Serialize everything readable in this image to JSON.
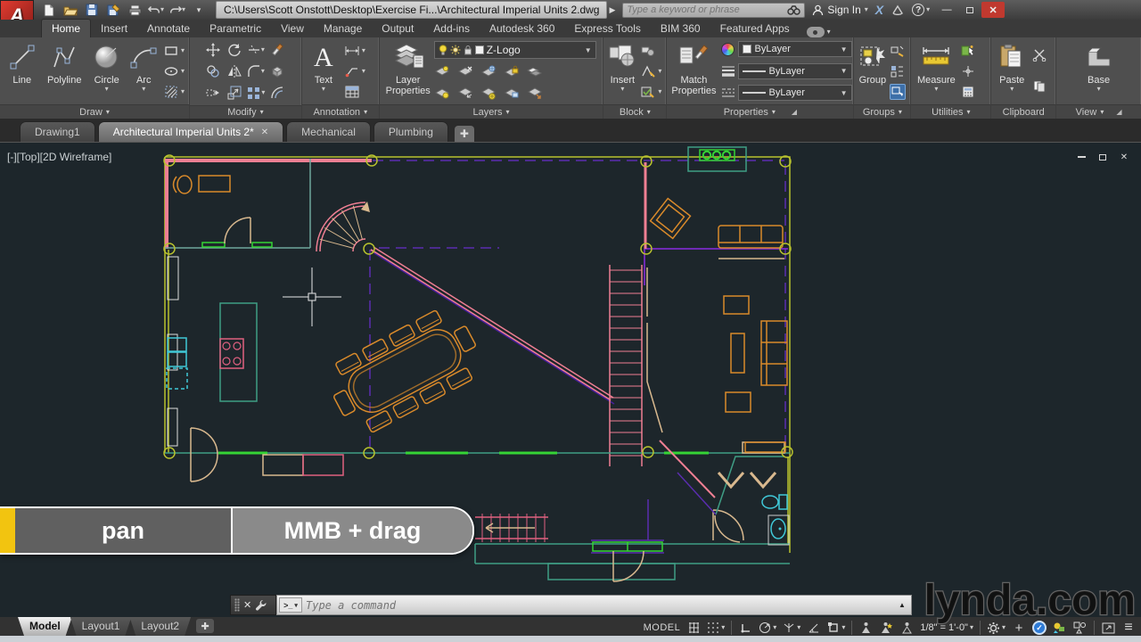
{
  "titlebar": {
    "file_path": "C:\\Users\\Scott Onstott\\Desktop\\Exercise Fi...\\Architectural Imperial Units 2.dwg",
    "search_placeholder": "Type a keyword or phrase",
    "signin": "Sign In"
  },
  "ribbon": {
    "tabs": [
      {
        "label": "Home"
      },
      {
        "label": "Insert"
      },
      {
        "label": "Annotate"
      },
      {
        "label": "Parametric"
      },
      {
        "label": "View"
      },
      {
        "label": "Manage"
      },
      {
        "label": "Output"
      },
      {
        "label": "Add-ins"
      },
      {
        "label": "Autodesk 360"
      },
      {
        "label": "Express Tools"
      },
      {
        "label": "BIM 360"
      },
      {
        "label": "Featured Apps"
      }
    ],
    "draw": {
      "label": "Draw",
      "line": "Line",
      "polyline": "Polyline",
      "circle": "Circle",
      "arc": "Arc"
    },
    "modify": {
      "label": "Modify"
    },
    "annotation": {
      "label": "Annotation",
      "text": "Text"
    },
    "layers": {
      "label": "Layers",
      "layer_properties": "Layer Properties",
      "current_layer": "Z-Logo"
    },
    "block": {
      "label": "Block",
      "insert": "Insert"
    },
    "properties": {
      "label": "Properties",
      "match": "Match Properties",
      "color": "ByLayer",
      "linetype": "ByLayer",
      "lineweight": "ByLayer"
    },
    "groups": {
      "label": "Groups",
      "group": "Group"
    },
    "utilities": {
      "label": "Utilities",
      "measure": "Measure"
    },
    "clipboard": {
      "label": "Clipboard",
      "paste": "Paste"
    },
    "view": {
      "label": "View",
      "base": "Base"
    }
  },
  "file_tabs": [
    {
      "label": "Drawing1"
    },
    {
      "label": "Architectural Imperial Units 2*"
    },
    {
      "label": "Mechanical"
    },
    {
      "label": "Plumbing"
    }
  ],
  "viewport": {
    "label": "[-][Top][2D Wireframe]"
  },
  "overlay": {
    "action": "pan",
    "shortcut": "MMB + drag",
    "accent_color": "#f2c410"
  },
  "command_line": {
    "placeholder": "Type a command"
  },
  "layout_tabs": [
    {
      "label": "Model"
    },
    {
      "label": "Layout1"
    },
    {
      "label": "Layout2"
    }
  ],
  "status_bar": {
    "space": "MODEL",
    "annotation_scale": "1/8\" = 1'-0\""
  },
  "watermark": "lynda.com",
  "canvas": {
    "background": "#1d262b",
    "colors": {
      "boundary_yellow_green": "#b8c22e",
      "walls_pink": "#ef7f93",
      "grid_purple": "#5b2db0",
      "walls_purple": "#8a2be2",
      "furniture_orange": "#d98a2b",
      "deck_teal": "#3f9e85",
      "fixtures_cyan": "#40c8d8",
      "doors_tan": "#d8b88e",
      "windows_green": "#35d435",
      "stove_pink": "#e06080"
    }
  }
}
